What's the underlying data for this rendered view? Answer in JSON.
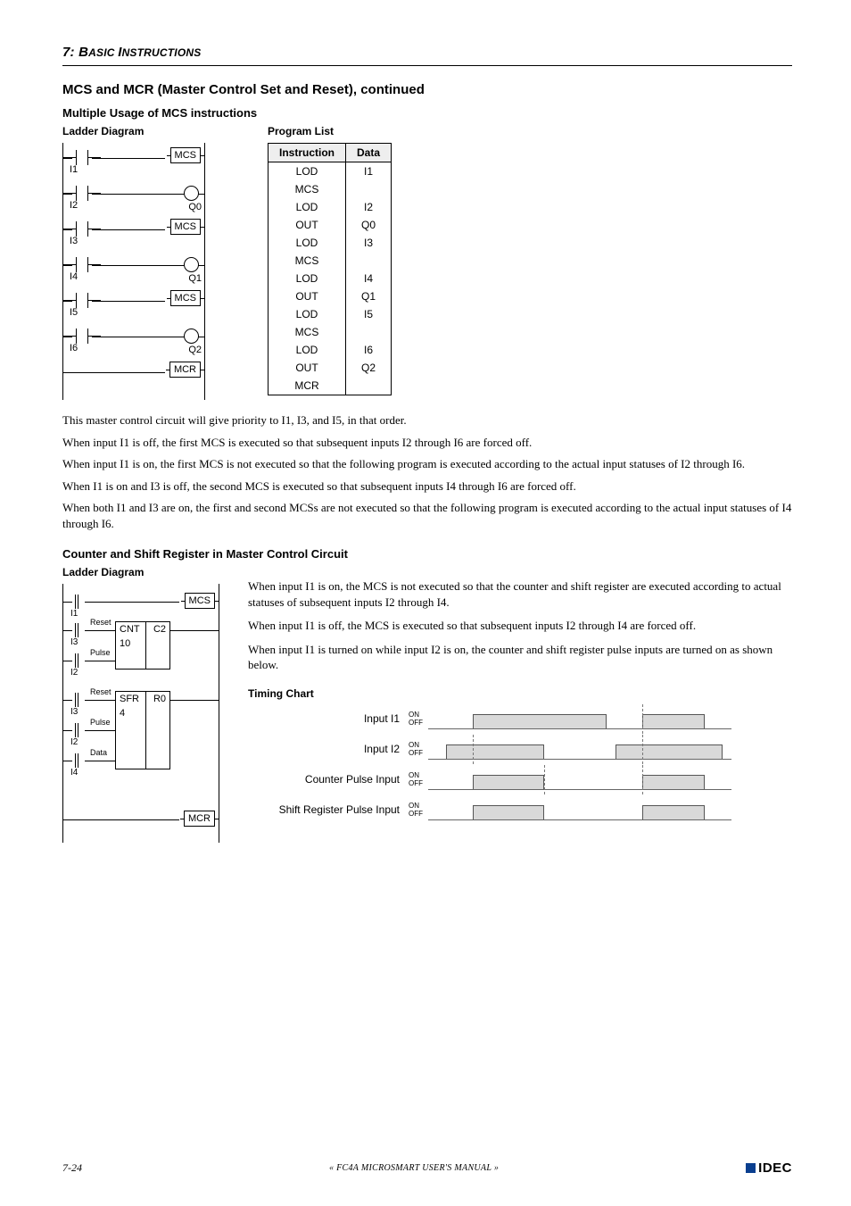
{
  "chapter": {
    "num": "7:",
    "title_small": "B",
    "title_rest": "ASIC ",
    "title_small2": "I",
    "title_rest2": "NSTRUCTIONS"
  },
  "h2_1": "MCS and MCR (Master Control Set and Reset), continued",
  "h3_1": "Multiple Usage of MCS instructions",
  "ladder1": {
    "heading": "Ladder Diagram",
    "mcs": "MCS",
    "mcr": "MCR",
    "i1": "I1",
    "i2": "I2",
    "i3": "I3",
    "i4": "I4",
    "i5": "I5",
    "i6": "I6",
    "q0": "Q0",
    "q1": "Q1",
    "q2": "Q2"
  },
  "proglist": {
    "heading": "Program List",
    "th1": "Instruction",
    "th2": "Data",
    "rows": [
      {
        "ins": "LOD",
        "data": "I1"
      },
      {
        "ins": "MCS",
        "data": ""
      },
      {
        "ins": "LOD",
        "data": "I2"
      },
      {
        "ins": "OUT",
        "data": "Q0"
      },
      {
        "ins": "LOD",
        "data": "I3"
      },
      {
        "ins": "MCS",
        "data": ""
      },
      {
        "ins": "LOD",
        "data": "I4"
      },
      {
        "ins": "OUT",
        "data": "Q1"
      },
      {
        "ins": "LOD",
        "data": "I5"
      },
      {
        "ins": "MCS",
        "data": ""
      },
      {
        "ins": "LOD",
        "data": "I6"
      },
      {
        "ins": "OUT",
        "data": "Q2"
      },
      {
        "ins": "MCR",
        "data": ""
      }
    ]
  },
  "para": {
    "p1": "This master control circuit will give priority to I1, I3, and I5, in that order.",
    "p2": "When input I1 is off, the first MCS is executed so that subsequent inputs I2 through I6 are forced off.",
    "p3": "When input I1 is on, the first MCS is not executed so that the following program is executed according to the actual input statuses of I2 through I6.",
    "p4": "When I1 is on and I3 is off, the second MCS is executed so that subsequent inputs I4 through I6 are forced off.",
    "p5": "When both I1 and I3 are on, the first and second MCSs are not executed so that the following program is executed according to the actual input statuses of I4 through I6."
  },
  "h3_2": "Counter and Shift Register in Master Control Circuit",
  "ladder2": {
    "heading": "Ladder Diagram",
    "mcs": "MCS",
    "mcr": "MCR",
    "i1": "I1",
    "i2": "I2",
    "i3": "I3",
    "i4": "I4",
    "reset": "Reset",
    "pulse": "Pulse",
    "data": "Data",
    "cnt": "CNT",
    "ten": "10",
    "c2": "C2",
    "sfr": "SFR",
    "four": "4",
    "r0": "R0"
  },
  "para2": {
    "p1": "When input I1 is on, the MCS is not executed so that the counter and shift register are executed according to actual statuses of subsequent inputs I2 through I4.",
    "p2": "When input I1 is off, the MCS is executed so that subsequent inputs I2 through I4 are forced off.",
    "p3": "When input I1 is turned on while input I2 is on, the counter and shift register pulse inputs are turned on as shown below."
  },
  "timing": {
    "heading": "Timing Chart",
    "on": "ON",
    "off": "OFF",
    "r1": "Input I1",
    "r2": "Input I2",
    "r3": "Counter Pulse Input",
    "r4": "Shift Register Pulse Input"
  },
  "footer": {
    "page": "7-24",
    "manual": "« FC4A MICROSMART USER'S MANUAL »",
    "brand": "IDEC"
  }
}
